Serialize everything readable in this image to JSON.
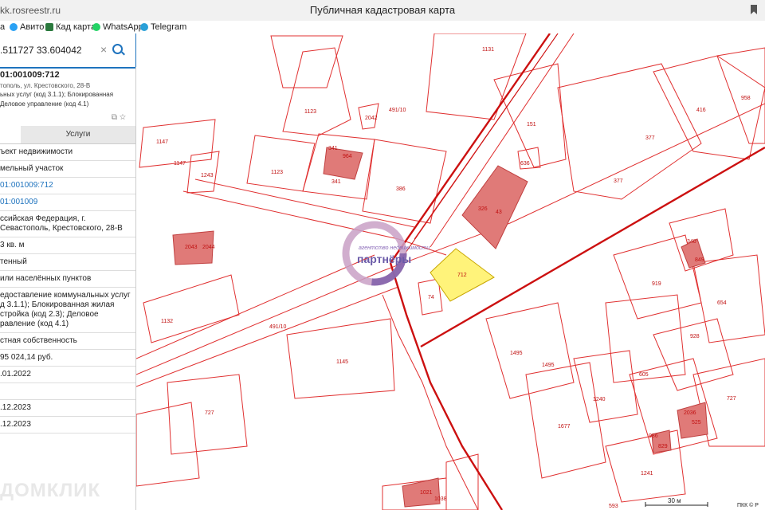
{
  "browser": {
    "url": "kk.rosreestr.ru",
    "title": "Публичная кадастровая карта",
    "bookmarks": [
      {
        "label": "а",
        "icon": "folder-icon",
        "color": "#888888"
      },
      {
        "label": "Авито",
        "icon": "avito-icon",
        "color": "#29a1f4"
      },
      {
        "label": "Кад карта",
        "icon": "map-icon",
        "color": "#2b7a3e"
      },
      {
        "label": "WhatsApp",
        "icon": "whatsapp-icon",
        "color": "#25d366"
      },
      {
        "label": "Telegram",
        "icon": "telegram-icon",
        "color": "#2aa0d8"
      }
    ]
  },
  "search": {
    "value": ".511727 33.604042",
    "clear": "×"
  },
  "object": {
    "number": "01:001009:712",
    "address": "тополь, ул. Крестовского, 28-В",
    "use_line1": "ьных услуг (код 3.1.1); Блокированная",
    "use_line2": "Деловое управление (код 4.1)"
  },
  "tabs": {
    "first": "",
    "second": "Услуги"
  },
  "rows": [
    {
      "text": "ъект недвижимости",
      "link": false
    },
    {
      "text": "мельный участок",
      "link": false
    },
    {
      "text": "01:001009:712",
      "link": true
    },
    {
      "text": "01:001009",
      "link": true
    },
    {
      "text": "ссийская Федерация, г. Севастополь, Крестовского, 28-В",
      "link": false
    },
    {
      "text": "3 кв. м",
      "link": false
    },
    {
      "text": "тенный",
      "link": false
    },
    {
      "text": "или населённых пунктов",
      "link": false
    },
    {
      "text": "едоставление коммунальных услуг д 3.1.1); Блокированная жилая стройка (код 2.3); Деловое равление (код 4.1)",
      "link": false
    },
    {
      "text": "стная собственность",
      "link": false
    },
    {
      "text": "95 024,14 руб.",
      "link": false
    },
    {
      "text": ".01.2022",
      "link": false
    },
    {
      "text": "",
      "link": false
    },
    {
      "text": ".12.2023",
      "link": false
    },
    {
      "text": ".12.2023",
      "link": false
    }
  ],
  "watermark": "ДОМКЛИК",
  "map": {
    "labels": [
      "1131",
      "491/10",
      "151",
      "416",
      "958",
      "1123",
      "2042",
      "341",
      "964",
      "341",
      "386",
      "377",
      "1147",
      "1147",
      "1243",
      "1123",
      "636",
      "326",
      "43",
      "377",
      "2043",
      "2044",
      "340",
      "849",
      "712",
      "74",
      "919",
      "654",
      "1132",
      "491/10",
      "1145",
      "928",
      "1495",
      "1495",
      "605",
      "1240",
      "727",
      "727",
      "1677",
      "986",
      "829",
      "525",
      "2036",
      "1241",
      "593",
      "1021",
      "1038"
    ],
    "parcel_color": "#ff0000",
    "building_color": "#e07a78",
    "selected_color": "#fff37a",
    "logo_text_top": "агентство недвижимости",
    "logo_text": "партнёры",
    "scale_label": "30 м",
    "attribution": "ПКК © Р"
  }
}
